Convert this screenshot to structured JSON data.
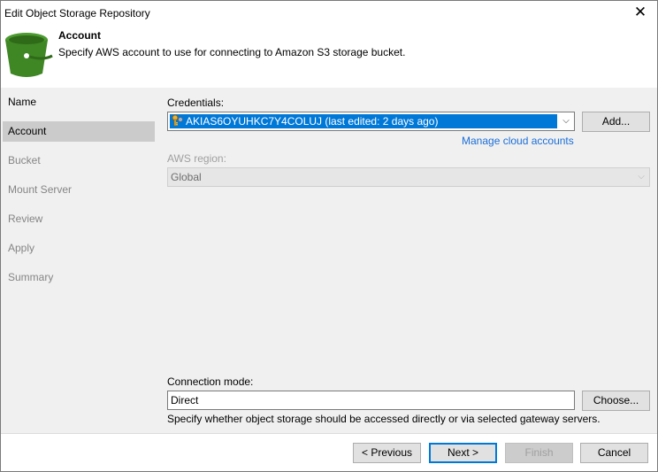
{
  "window": {
    "title": "Edit Object Storage Repository",
    "close_glyph": "✕"
  },
  "header": {
    "title": "Account",
    "description": "Specify AWS account to use for connecting to Amazon S3 storage bucket.",
    "icon": "s3-bucket-icon",
    "icon_color": "#3f8624"
  },
  "sidebar": {
    "items": [
      {
        "label": "Name",
        "state": "done"
      },
      {
        "label": "Account",
        "state": "active"
      },
      {
        "label": "Bucket",
        "state": "pending"
      },
      {
        "label": "Mount Server",
        "state": "pending"
      },
      {
        "label": "Review",
        "state": "pending"
      },
      {
        "label": "Apply",
        "state": "pending"
      },
      {
        "label": "Summary",
        "state": "pending"
      }
    ]
  },
  "credentials": {
    "label": "Credentials:",
    "selected": "AKIAS6OYUHKC7Y4COLUJ (last edited: 2 days ago)",
    "icon": "key-icon",
    "add_label": "Add...",
    "manage_link": "Manage cloud accounts"
  },
  "region": {
    "label": "AWS region:",
    "selected": "Global"
  },
  "connection": {
    "label": "Connection mode:",
    "value": "Direct",
    "choose_label": "Choose...",
    "hint": "Specify whether object storage should be accessed directly or via selected gateway servers."
  },
  "footer": {
    "previous_label": "< Previous",
    "next_label": "Next >",
    "finish_label": "Finish",
    "cancel_label": "Cancel"
  },
  "colors": {
    "selection": "#0078d7",
    "link": "#1a6ed8",
    "panel": "#f0f0f0"
  }
}
